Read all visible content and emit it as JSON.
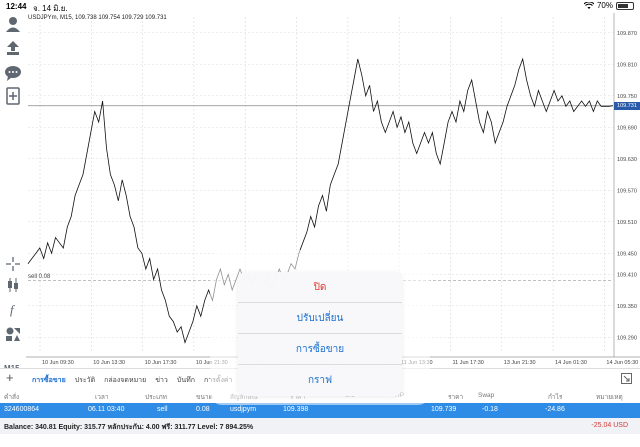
{
  "status": {
    "time": "12:44",
    "date": "จ. 14 มิ.ย.",
    "battery": "70%",
    "battery_level": 0.7
  },
  "chart": {
    "symbol_line": "USDJPYm, M15, 109.738 109.754 109.729 109.731",
    "current_price": "109.731",
    "sell_label": "sell 0.08",
    "y_ticks": [
      "109.870",
      "109.810",
      "109.750",
      "109.690",
      "109.630",
      "109.570",
      "109.510",
      "109.450",
      "109.410",
      "109.350",
      "109.290"
    ],
    "x_ticks": [
      "10 Jun 09:30",
      "10 Jun 13:30",
      "10 Jun 17:30",
      "10 Jun 21:30",
      "11 Jun 01:30",
      "11 Jun 05:30",
      "11 Jun 09:30",
      "11 Jun 13:30",
      "11 Jun 17:30",
      "13 Jun 21:30",
      "14 Jun 01:30",
      "14 Jun 05:30"
    ],
    "timeframe": "M15",
    "colors": {
      "line": "#111111",
      "grid": "#d9d9d9",
      "price_tag": "#2a5aa8"
    }
  },
  "chart_data": {
    "type": "line",
    "title": "USDJPYm, M15, 109.738 109.754 109.729 109.731",
    "xlabel": "",
    "ylabel": "",
    "ylim": [
      109.26,
      109.9
    ],
    "price_line": 109.731,
    "sell_line": 109.398,
    "x": [
      0,
      1,
      2,
      3,
      4,
      5,
      6,
      7,
      8,
      9,
      10,
      11,
      12,
      13,
      14,
      15,
      16,
      17,
      18,
      19,
      20,
      21,
      22,
      23,
      24,
      25,
      26,
      27,
      28,
      29,
      30,
      31,
      32,
      33,
      34,
      35,
      36,
      37,
      38,
      39,
      40,
      41,
      42,
      43,
      44,
      45,
      46,
      47,
      48,
      49,
      50,
      51,
      52,
      53,
      54,
      55,
      56,
      57,
      58,
      59,
      60,
      61,
      62,
      63,
      64,
      65,
      66,
      67,
      68,
      69,
      70,
      71,
      72,
      73,
      74,
      75,
      76,
      77,
      78,
      79,
      80,
      81,
      82,
      83,
      84,
      85,
      86,
      87,
      88,
      89,
      90,
      91,
      92,
      93,
      94,
      95,
      96,
      97,
      98,
      99,
      100,
      101,
      102,
      103,
      104,
      105,
      106,
      107,
      108,
      109,
      110,
      111,
      112,
      113,
      114,
      115,
      116,
      117,
      118,
      119,
      120,
      121,
      122,
      123,
      124,
      125,
      126,
      127,
      128,
      129,
      130,
      131,
      132,
      133,
      134,
      135,
      136,
      137,
      138,
      139,
      140,
      141,
      142,
      143,
      144,
      145,
      146,
      147,
      148,
      149
    ],
    "series": [
      {
        "values": [
          109.43,
          109.44,
          109.45,
          109.46,
          109.44,
          109.47,
          109.45,
          109.48,
          109.47,
          109.46,
          109.5,
          109.52,
          109.56,
          109.58,
          109.6,
          109.64,
          109.68,
          109.72,
          109.7,
          109.74,
          109.65,
          109.6,
          109.58,
          109.55,
          109.59,
          109.56,
          109.52,
          109.5,
          109.46,
          109.45,
          109.42,
          109.44,
          109.4,
          109.42,
          109.38,
          109.36,
          109.33,
          109.32,
          109.3,
          109.31,
          109.28,
          109.3,
          109.32,
          109.35,
          109.33,
          109.36,
          109.38,
          109.36,
          109.4,
          109.42,
          109.39,
          109.41,
          109.38,
          109.4,
          109.42,
          109.4,
          109.41,
          109.39,
          109.41,
          109.4,
          109.39,
          109.41,
          109.38,
          109.4,
          109.42,
          109.4,
          109.41,
          109.43,
          109.42,
          109.45,
          109.47,
          109.49,
          109.52,
          109.5,
          109.54,
          109.56,
          109.53,
          109.58,
          109.6,
          109.62,
          109.66,
          109.7,
          109.74,
          109.78,
          109.82,
          109.79,
          109.75,
          109.77,
          109.72,
          109.74,
          109.7,
          109.68,
          109.7,
          109.72,
          109.69,
          109.71,
          109.68,
          109.7,
          109.66,
          109.64,
          109.66,
          109.68,
          109.66,
          109.68,
          109.64,
          109.62,
          109.66,
          109.7,
          109.72,
          109.7,
          109.74,
          109.72,
          109.76,
          109.78,
          109.74,
          109.7,
          109.68,
          109.72,
          109.7,
          109.66,
          109.68,
          109.7,
          109.73,
          109.75,
          109.77,
          109.8,
          109.82,
          109.78,
          109.75,
          109.73,
          109.76,
          109.74,
          109.72,
          109.74,
          109.76,
          109.74,
          109.75,
          109.73,
          109.74,
          109.72,
          109.73,
          109.74,
          109.73,
          109.74,
          109.72,
          109.74,
          109.73,
          109.73,
          109.73,
          109.731
        ]
      }
    ]
  },
  "tabs": [
    "การซื้อขาย",
    "ประวัติ",
    "กล่องจดหมาย",
    "ข่าว",
    "บันทึก",
    "การตั้งค่า"
  ],
  "active_tab": "การซื้อขาย",
  "columns": [
    "คำสั่ง",
    "เวลา",
    "ประเภท",
    "ขนาด",
    "สัญลักษณ์",
    "ราคา",
    "S/L",
    "T/P",
    "ราคา",
    "Swap",
    "กำไร",
    "หมายเหตุ"
  ],
  "position": {
    "ticket": "324600864",
    "time": "06.11 03:40",
    "type": "sell",
    "size": "0.08",
    "symbol": "usdjpym",
    "open_price": "109.398",
    "price": "109.739",
    "swap": "-0.18",
    "profit": "-24.86"
  },
  "balance_line": "Balance: 340.81  Equity: 315.77  หลักประกัน: 4.00  ฟรี: 311.77  Level: 7 894.25%",
  "total_pl": "-25.04  USD",
  "action_sheet": {
    "items": [
      {
        "label": "ปิด",
        "destructive": true
      },
      {
        "label": "ปรับเปลี่ยน",
        "destructive": false
      },
      {
        "label": "การซื้อขาย",
        "destructive": false
      },
      {
        "label": "กราฟ",
        "destructive": false
      }
    ]
  }
}
